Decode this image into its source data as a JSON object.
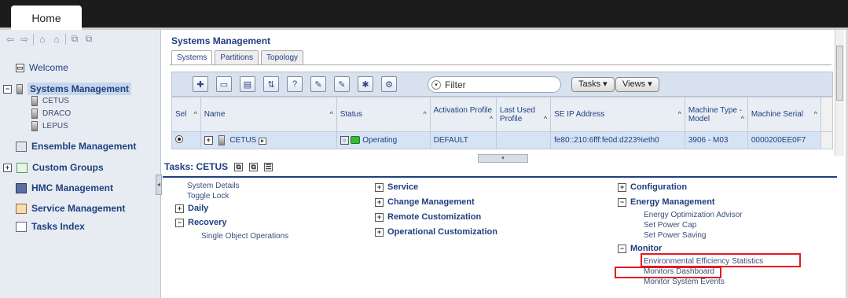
{
  "home_tab": "Home",
  "nav": {
    "items": [
      {
        "label": "Welcome"
      },
      {
        "label": "Systems Management"
      },
      {
        "label": "Ensemble Management"
      },
      {
        "label": "Custom Groups"
      },
      {
        "label": "HMC Management"
      },
      {
        "label": "Service Management"
      },
      {
        "label": "Tasks Index"
      }
    ],
    "systems": [
      "CETUS",
      "DRACO",
      "LEPUS"
    ]
  },
  "main": {
    "title": "Systems Management",
    "tabs": [
      "Systems",
      "Partitions",
      "Topology"
    ],
    "filter_placeholder": "Filter",
    "tasks_button": "Tasks ▾",
    "views_button": "Views ▾",
    "columns": [
      "Sel",
      "Name",
      "Status",
      "Activation Profile",
      "Last Used Profile",
      "SE IP Address",
      "Machine Type - Model",
      "Machine Serial"
    ],
    "row": {
      "name": "CETUS",
      "status": "Operating",
      "activation_profile": "DEFAULT",
      "last_used_profile": "",
      "ip": "fe80::210:6fff:fe0d:d223%eth0",
      "model": "3906 - M03",
      "serial": "0000200EE0F7"
    }
  },
  "tasks": {
    "title": "Tasks: CETUS",
    "left": {
      "system_details": "System Details",
      "toggle_lock": "Toggle Lock",
      "daily": "Daily",
      "recovery": "Recovery",
      "single_object": "Single Object Operations"
    },
    "middle": {
      "service": "Service",
      "change_management": "Change Management",
      "remote_customization": "Remote Customization",
      "operational_customization": "Operational Customization"
    },
    "right": {
      "configuration": "Configuration",
      "energy_management": "Energy Management",
      "energy_optimization": "Energy Optimization Advisor",
      "set_power_cap": "Set Power Cap",
      "set_power_saving": "Set Power Saving",
      "monitor": "Monitor",
      "env_efficiency": "Environmental Efficiency Statistics",
      "monitors_dashboard": "Monitors Dashboard",
      "monitor_system_events": "Monitor System Events"
    }
  }
}
